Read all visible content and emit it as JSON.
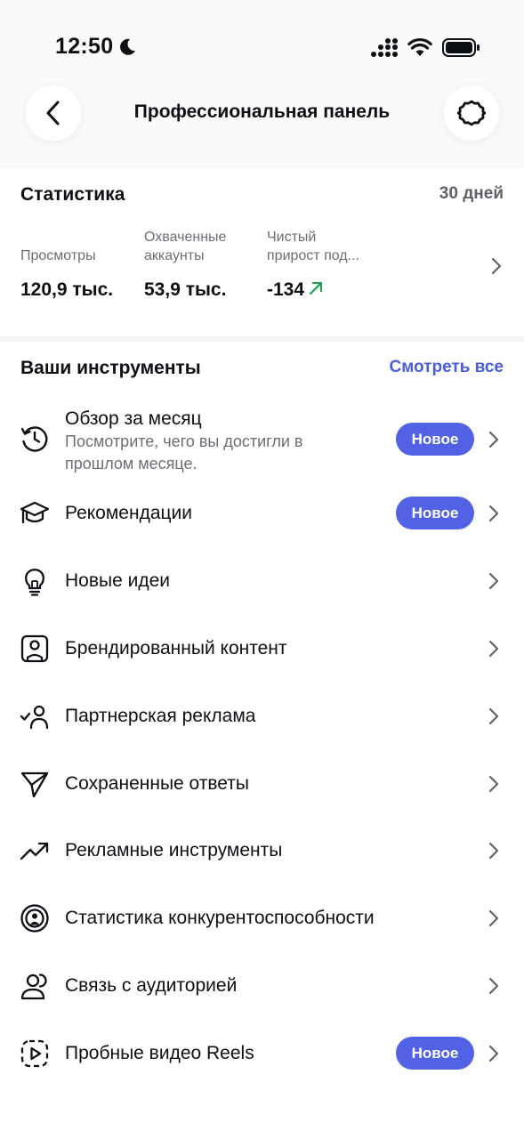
{
  "status_bar": {
    "time": "12:50"
  },
  "header": {
    "title": "Профессиональная панель"
  },
  "stats": {
    "title": "Статистика",
    "period": "30 дней",
    "metrics": [
      {
        "label_lines": [
          "Просмотры"
        ],
        "value": "120,9 тыс."
      },
      {
        "label_lines": [
          "Охваченные",
          "аккаунты"
        ],
        "value": "53,9 тыс."
      },
      {
        "label_lines": [
          "Чистый",
          "прирост под..."
        ],
        "value": "-134"
      }
    ],
    "accent_color": "#1f9d55"
  },
  "tools": {
    "title": "Ваши инструменты",
    "see_all": "Смотреть все",
    "badge_label": "Новое",
    "items": [
      {
        "label": "Обзор за месяц",
        "subtitle": "Посмотрите, чего вы достигли в прошлом месяце.",
        "icon": "history-clock-icon",
        "badge": true
      },
      {
        "label": "Рекомендации",
        "icon": "graduation-cap-icon",
        "badge": true
      },
      {
        "label": "Новые идеи",
        "icon": "lightbulb-icon",
        "badge": false
      },
      {
        "label": "Брендированный контент",
        "icon": "branded-content-icon",
        "badge": false
      },
      {
        "label": "Партнерская реклама",
        "icon": "partner-check-person-icon",
        "badge": false
      },
      {
        "label": "Сохраненные ответы",
        "icon": "paper-plane-icon",
        "badge": false
      },
      {
        "label": "Рекламные инструменты",
        "icon": "trend-up-icon",
        "badge": false
      },
      {
        "label": "Статистика конкурентоспособности",
        "icon": "target-person-icon",
        "badge": false
      },
      {
        "label": "Связь с аудиторией",
        "icon": "audience-icon",
        "badge": false
      },
      {
        "label": "Пробные видео Reels",
        "icon": "reels-trial-icon",
        "badge": true
      }
    ]
  },
  "colors": {
    "accent": "#4a5ddb",
    "badge_bg": "#5162e6",
    "text": "#0c1014",
    "muted": "#6b6f75"
  }
}
